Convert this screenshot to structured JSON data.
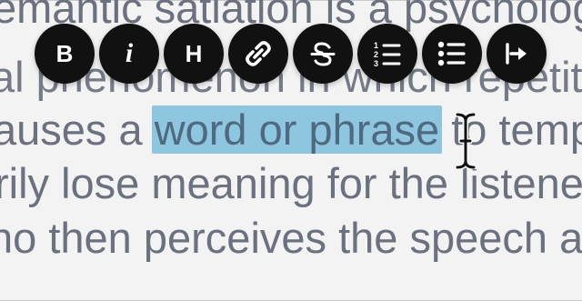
{
  "editor": {
    "lines": [
      "emantic satiation is a psychologi",
      "al phenomenon in which repetiti",
      "auses a ",
      "rily lose meaning for the listene",
      "ho then perceives the speech a"
    ],
    "selected_text": "word or phrase",
    "after_selection": " to temp"
  },
  "toolbar": {
    "buttons": [
      {
        "icon": "bold-icon",
        "glyph": "B"
      },
      {
        "icon": "italic-icon",
        "glyph": "i"
      },
      {
        "icon": "heading-icon",
        "glyph": "H"
      },
      {
        "icon": "link-icon"
      },
      {
        "icon": "strikethrough-icon"
      },
      {
        "icon": "numbered-list-icon"
      },
      {
        "icon": "bulleted-list-icon"
      },
      {
        "icon": "indent-icon"
      }
    ]
  },
  "colors": {
    "background": "#f3f3f3",
    "text": "#6b717e",
    "selection": "#8ec5df",
    "toolbar_button": "#111111",
    "toolbar_icon": "#ffffff"
  }
}
